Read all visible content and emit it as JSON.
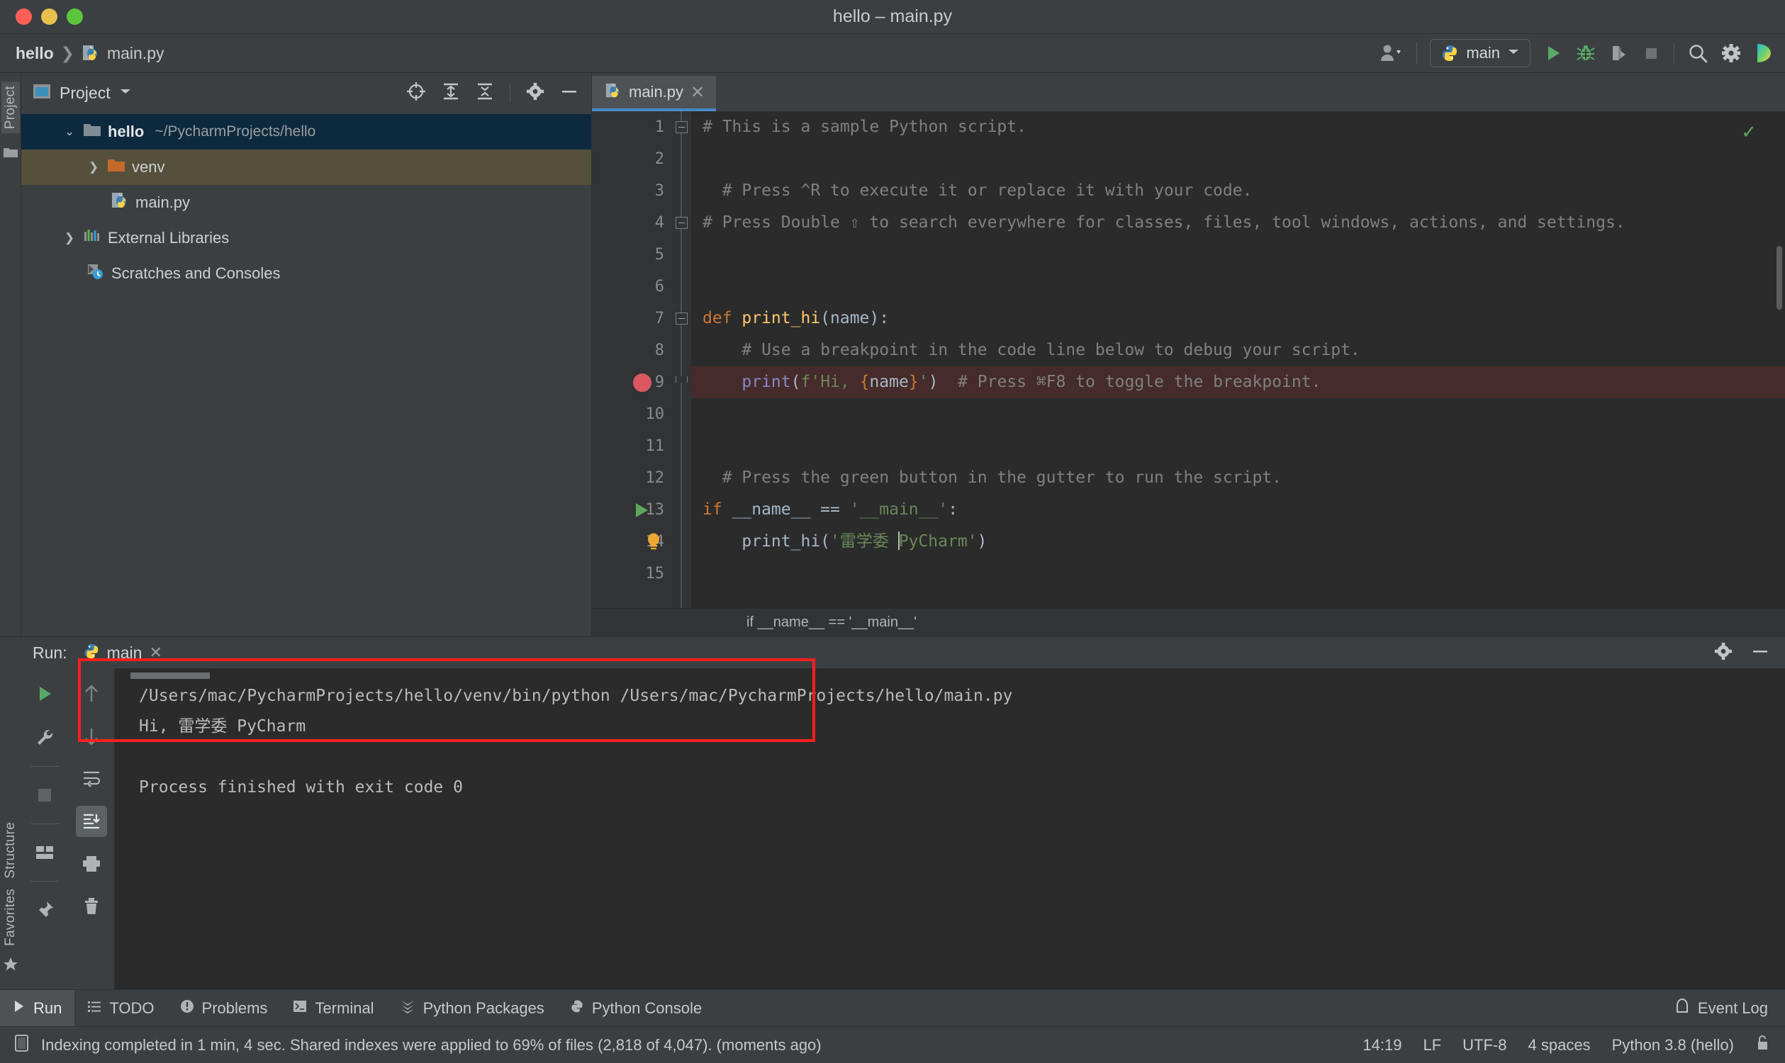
{
  "window": {
    "title": "hello – main.py",
    "traffic_lights": [
      "close",
      "minimize",
      "maximize"
    ]
  },
  "breadcrumbs": [
    {
      "label": "hello",
      "icon": "none"
    },
    {
      "label": "main.py",
      "icon": "python-file-icon"
    }
  ],
  "toolbar": {
    "account_icon": "user-account-icon",
    "run_config": {
      "label": "main",
      "icon": "python-icon",
      "chevron": "chevron-down-icon"
    },
    "actions": [
      {
        "name": "run-button",
        "icon": "play-icon"
      },
      {
        "name": "debug-button",
        "icon": "bug-icon"
      },
      {
        "name": "coverage-button",
        "icon": "run-with-coverage-icon"
      },
      {
        "name": "stop-button",
        "icon": "stop-icon"
      },
      {
        "name": "search-everywhere-button",
        "icon": "search-icon"
      },
      {
        "name": "settings-button",
        "icon": "gear-icon"
      },
      {
        "name": "jetbrains-toolbox-button",
        "icon": "gradient-logo-icon"
      }
    ]
  },
  "left_rail": {
    "labels": [
      "Project"
    ],
    "bottom_labels": [
      "Structure",
      "Favorites"
    ]
  },
  "project_panel": {
    "title": "Project",
    "chevron": "chevron-down-icon",
    "header_icons": [
      {
        "name": "select-opened-file-button",
        "icon": "target-icon"
      },
      {
        "name": "expand-all-button",
        "icon": "expand-all-icon"
      },
      {
        "name": "collapse-all-button",
        "icon": "collapse-all-icon"
      },
      {
        "name": "panel-settings-button",
        "icon": "gear-icon"
      },
      {
        "name": "hide-panel-button",
        "icon": "minimize-icon"
      }
    ],
    "tree": [
      {
        "label": "hello",
        "path": "~/PycharmProjects/hello",
        "icon": "folder-module-icon",
        "expanded": true,
        "selected": true,
        "indent": 0
      },
      {
        "label": "venv",
        "path": "",
        "icon": "folder-excluded-icon",
        "expanded": false,
        "highlight": "olive",
        "indent": 1
      },
      {
        "label": "main.py",
        "path": "",
        "icon": "python-file-icon",
        "indent": 2
      },
      {
        "label": "External Libraries",
        "path": "",
        "icon": "libraries-icon",
        "expanded": false,
        "indent": 0
      },
      {
        "label": "Scratches and Consoles",
        "path": "",
        "icon": "scratches-icon",
        "indent": 0
      }
    ]
  },
  "editor": {
    "tab": {
      "label": "main.py",
      "icon": "python-file-icon",
      "close": "close-icon"
    },
    "inspection_status": "✓",
    "breadcrumb": "if __name__ == '__main__'",
    "lines": [
      {
        "no": "1",
        "segments": [
          {
            "t": "# This is a sample Python script.",
            "c": "cm"
          }
        ]
      },
      {
        "no": "2",
        "segments": []
      },
      {
        "no": "3",
        "segments": [
          {
            "t": "  # Press ^R to execute it or replace it with your code.",
            "c": "cm"
          }
        ]
      },
      {
        "no": "4",
        "segments": [
          {
            "t": "# Press Double ⇧ to search everywhere for classes, files, tool windows, actions, and settings.",
            "c": "cm"
          }
        ]
      },
      {
        "no": "5",
        "segments": []
      },
      {
        "no": "6",
        "segments": []
      },
      {
        "no": "7",
        "segments": [
          {
            "t": "def ",
            "c": "kw"
          },
          {
            "t": "print_hi",
            "c": "fn"
          },
          {
            "t": "(name):",
            "c": "pl"
          }
        ]
      },
      {
        "no": "8",
        "segments": [
          {
            "t": "    # Use a breakpoint in the code line below to debug your script.",
            "c": "cm"
          }
        ]
      },
      {
        "no": "9",
        "highlight": true,
        "segments": [
          {
            "t": "    ",
            "c": "pl"
          },
          {
            "t": "print",
            "c": "pr"
          },
          {
            "t": "(",
            "c": "pl"
          },
          {
            "t": "f'Hi, ",
            "c": "st"
          },
          {
            "t": "{",
            "c": "br"
          },
          {
            "t": "name",
            "c": "pl"
          },
          {
            "t": "}",
            "c": "br"
          },
          {
            "t": "'",
            "c": "st"
          },
          {
            "t": ")",
            "c": "pl"
          },
          {
            "t": "  # Press ⌘F8 to toggle the breakpoint.",
            "c": "cm"
          }
        ]
      },
      {
        "no": "10",
        "segments": []
      },
      {
        "no": "11",
        "segments": []
      },
      {
        "no": "12",
        "segments": [
          {
            "t": "  # Press the green button in the gutter to run the script.",
            "c": "cm"
          }
        ]
      },
      {
        "no": "13",
        "segments": [
          {
            "t": "if ",
            "c": "kw"
          },
          {
            "t": "__name__ == ",
            "c": "pl"
          },
          {
            "t": "'__main__'",
            "c": "st"
          },
          {
            "t": ":",
            "c": "pl"
          }
        ]
      },
      {
        "no": "14",
        "segments": [
          {
            "t": "    ",
            "c": "pl"
          },
          {
            "t": "print_hi",
            "c": "pl"
          },
          {
            "t": "(",
            "c": "pl"
          },
          {
            "t": "'雷学委 ",
            "c": "st"
          },
          {
            "t": "CARET",
            "c": "caret"
          },
          {
            "t": "PyCharm'",
            "c": "st"
          },
          {
            "t": ")",
            "c": "pl"
          }
        ]
      },
      {
        "no": "15",
        "segments": []
      }
    ],
    "gutter_markers": [
      {
        "name": "breakpoint-marker",
        "line": 9,
        "icon": "breakpoint-icon"
      },
      {
        "name": "run-line-marker",
        "line": 13,
        "icon": "play-icon"
      },
      {
        "name": "intention-bulb",
        "line": 14,
        "icon": "lightbulb-icon"
      }
    ]
  },
  "run_panel": {
    "header_label": "Run:",
    "tab": {
      "label": "main",
      "icon": "python-icon",
      "close": "close-icon"
    },
    "header_right": [
      {
        "name": "run-settings-button",
        "icon": "gear-icon"
      },
      {
        "name": "hide-run-panel-button",
        "icon": "minimize-icon"
      }
    ],
    "tools_left": [
      {
        "name": "rerun-button",
        "icon": "play-icon"
      },
      {
        "name": "edit-configuration-button",
        "icon": "wrench-icon"
      },
      {
        "name": "stop-button",
        "icon": "stop-icon"
      },
      {
        "name": "layout-settings-button",
        "icon": "layout-icon"
      },
      {
        "name": "pin-tab-button",
        "icon": "pin-icon"
      }
    ],
    "tools_right": [
      {
        "name": "previous-occurrence-button",
        "icon": "arrow-up-icon"
      },
      {
        "name": "next-occurrence-button",
        "icon": "arrow-down-icon"
      },
      {
        "name": "soft-wrap-button",
        "icon": "soft-wrap-icon"
      },
      {
        "name": "scroll-to-end-button",
        "icon": "scroll-to-end-icon",
        "active": true
      },
      {
        "name": "print-button",
        "icon": "print-icon"
      },
      {
        "name": "clear-all-button",
        "icon": "trash-icon"
      }
    ],
    "console_lines": [
      "/Users/mac/PycharmProjects/hello/venv/bin/python /Users/mac/PycharmProjects/hello/main.py",
      "Hi, 雷学委 PyCharm",
      "",
      "Process finished with exit code 0"
    ],
    "annotation": {
      "name": "red-highlight-box",
      "color": "#ff1f1f"
    }
  },
  "bottom_tabs": [
    {
      "label": "Run",
      "icon": "play-icon",
      "selected": true
    },
    {
      "label": "TODO",
      "icon": "todo-icon",
      "selected": false
    },
    {
      "label": "Problems",
      "icon": "problems-icon",
      "selected": false
    },
    {
      "label": "Terminal",
      "icon": "terminal-icon",
      "selected": false
    },
    {
      "label": "Python Packages",
      "icon": "packages-icon",
      "selected": false
    },
    {
      "label": "Python Console",
      "icon": "python-icon",
      "selected": false
    }
  ],
  "event_log": {
    "label": "Event Log",
    "icon": "event-log-icon"
  },
  "status_bar": {
    "message": "Indexing completed in 1 min, 4 sec. Shared indexes were applied to 69% of files (2,818 of 4,047). (moments ago)",
    "icon": "status-document-icon",
    "right": [
      {
        "name": "caret-position",
        "label": "14:19"
      },
      {
        "name": "line-separator",
        "label": "LF"
      },
      {
        "name": "file-encoding",
        "label": "UTF-8"
      },
      {
        "name": "indent-setting",
        "label": "4 spaces"
      },
      {
        "name": "python-interpreter",
        "label": "Python 3.8 (hello)"
      },
      {
        "name": "readonly-toggle",
        "label": "",
        "icon": "lock-open-icon"
      }
    ]
  },
  "colors": {
    "background": "#3c3f41",
    "editor_bg": "#2b2b2b",
    "gutter_bg": "#313335",
    "selection_blue": "#0d293e",
    "tab_accent": "#4a88c7",
    "accent_green": "#5ba85b",
    "breakpoint_red": "#db5860",
    "annotation_red": "#ff1f1f",
    "keyword_orange": "#cc7832",
    "string_green": "#6a8759",
    "function_yellow": "#ffc66d",
    "comment_gray": "#808080"
  }
}
